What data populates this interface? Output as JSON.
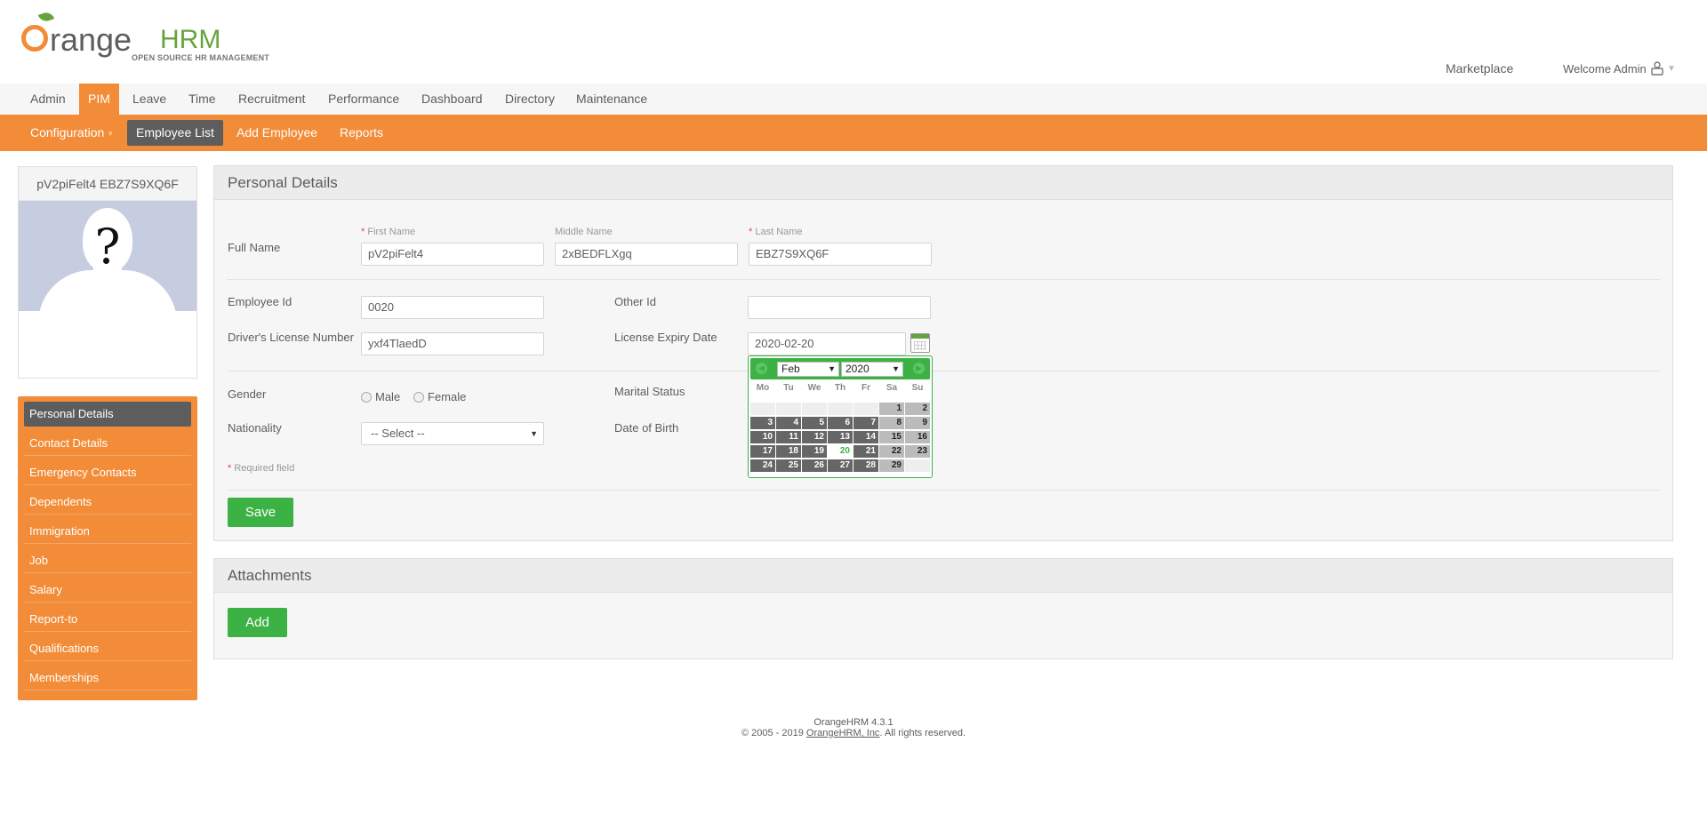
{
  "header": {
    "logo_word": "range",
    "logo_hrm": "HRM",
    "logo_tagline": "OPEN SOURCE HR MANAGEMENT",
    "marketplace": "Marketplace",
    "welcome": "Welcome Admin"
  },
  "main_menu": [
    "Admin",
    "PIM",
    "Leave",
    "Time",
    "Recruitment",
    "Performance",
    "Dashboard",
    "Directory",
    "Maintenance"
  ],
  "main_menu_active": "PIM",
  "sub_menu": [
    "Configuration",
    "Employee List",
    "Add Employee",
    "Reports"
  ],
  "sub_menu_active": "Employee List",
  "profile": {
    "name": "pV2piFelt4 EBZ7S9XQ6F",
    "photo_placeholder": "?"
  },
  "side_nav": [
    "Personal Details",
    "Contact Details",
    "Emergency Contacts",
    "Dependents",
    "Immigration",
    "Job",
    "Salary",
    "Report-to",
    "Qualifications",
    "Memberships"
  ],
  "side_nav_active": "Personal Details",
  "personal_details": {
    "title": "Personal Details",
    "full_name_label": "Full Name",
    "first_name_label": "First Name",
    "middle_name_label": "Middle Name",
    "last_name_label": "Last Name",
    "first_name": "pV2piFelt4",
    "middle_name": "2xBEDFLXgq",
    "last_name": "EBZ7S9XQ6F",
    "employee_id_label": "Employee Id",
    "employee_id": "0020",
    "other_id_label": "Other Id",
    "other_id": "",
    "license_label": "Driver's License Number",
    "license": "yxf4TlaedD",
    "license_expiry_label": "License Expiry Date",
    "license_expiry": "2020-02-20",
    "gender_label": "Gender",
    "gender_male": "Male",
    "gender_female": "Female",
    "marital_label": "Marital Status",
    "nationality_label": "Nationality",
    "nationality_value": "-- Select --",
    "dob_label": "Date of Birth",
    "required_note": "Required field",
    "required_star": "*",
    "save": "Save"
  },
  "datepicker": {
    "month": "Feb",
    "year": "2020",
    "weekdays": [
      "Mo",
      "Tu",
      "We",
      "Th",
      "Fr",
      "Sa",
      "Su"
    ],
    "selected_day": 20,
    "first_weekday_index": 5,
    "days_in_month": 29
  },
  "attachments": {
    "title": "Attachments",
    "add": "Add"
  },
  "footer": {
    "version": "OrangeHRM 4.3.1",
    "copyright_prefix": "© 2005 - 2019 ",
    "company_link": "OrangeHRM, Inc",
    "copyright_suffix": ". All rights reserved."
  },
  "colors": {
    "brand_orange": "#f28c38",
    "brand_green": "#67a33c",
    "button_green": "#3bb243",
    "text_gray": "#5d5d5d"
  }
}
